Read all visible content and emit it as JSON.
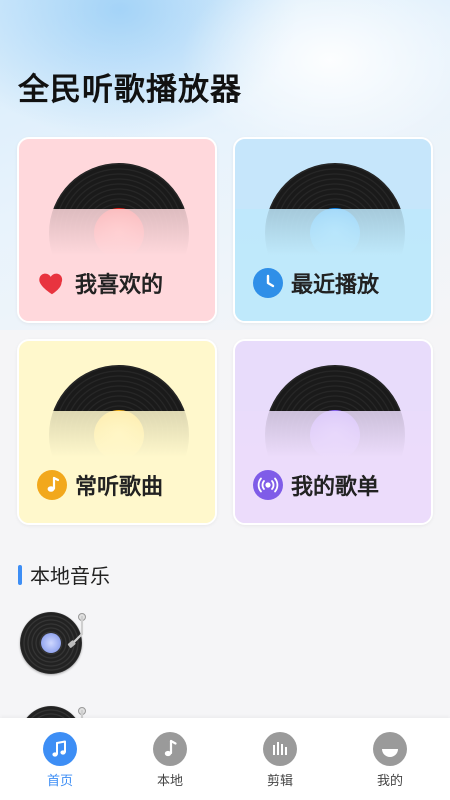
{
  "app": {
    "title": "全民听歌播放器"
  },
  "cards": [
    {
      "label": "我喜欢的",
      "icon": "heart-icon",
      "color": "#e8343f"
    },
    {
      "label": "最近播放",
      "icon": "clock-icon",
      "color": "#2f8fe8"
    },
    {
      "label": "常听歌曲",
      "icon": "music-note-icon",
      "color": "#f2a81c"
    },
    {
      "label": "我的歌单",
      "icon": "playlist-radio-icon",
      "color": "#7f5ce8"
    }
  ],
  "local_music": {
    "title": "本地音乐",
    "items": [
      {
        "icon": "vinyl-record-icon"
      },
      {
        "icon": "vinyl-record-icon"
      }
    ]
  },
  "tabbar": {
    "active_color": "#3d8ef5",
    "items": [
      {
        "label": "首页",
        "icon": "music-note-icon",
        "active": true
      },
      {
        "label": "本地",
        "icon": "music-note-icon",
        "active": false
      },
      {
        "label": "剪辑",
        "icon": "equalizer-icon",
        "active": false
      },
      {
        "label": "我的",
        "icon": "profile-icon",
        "active": false
      }
    ]
  }
}
